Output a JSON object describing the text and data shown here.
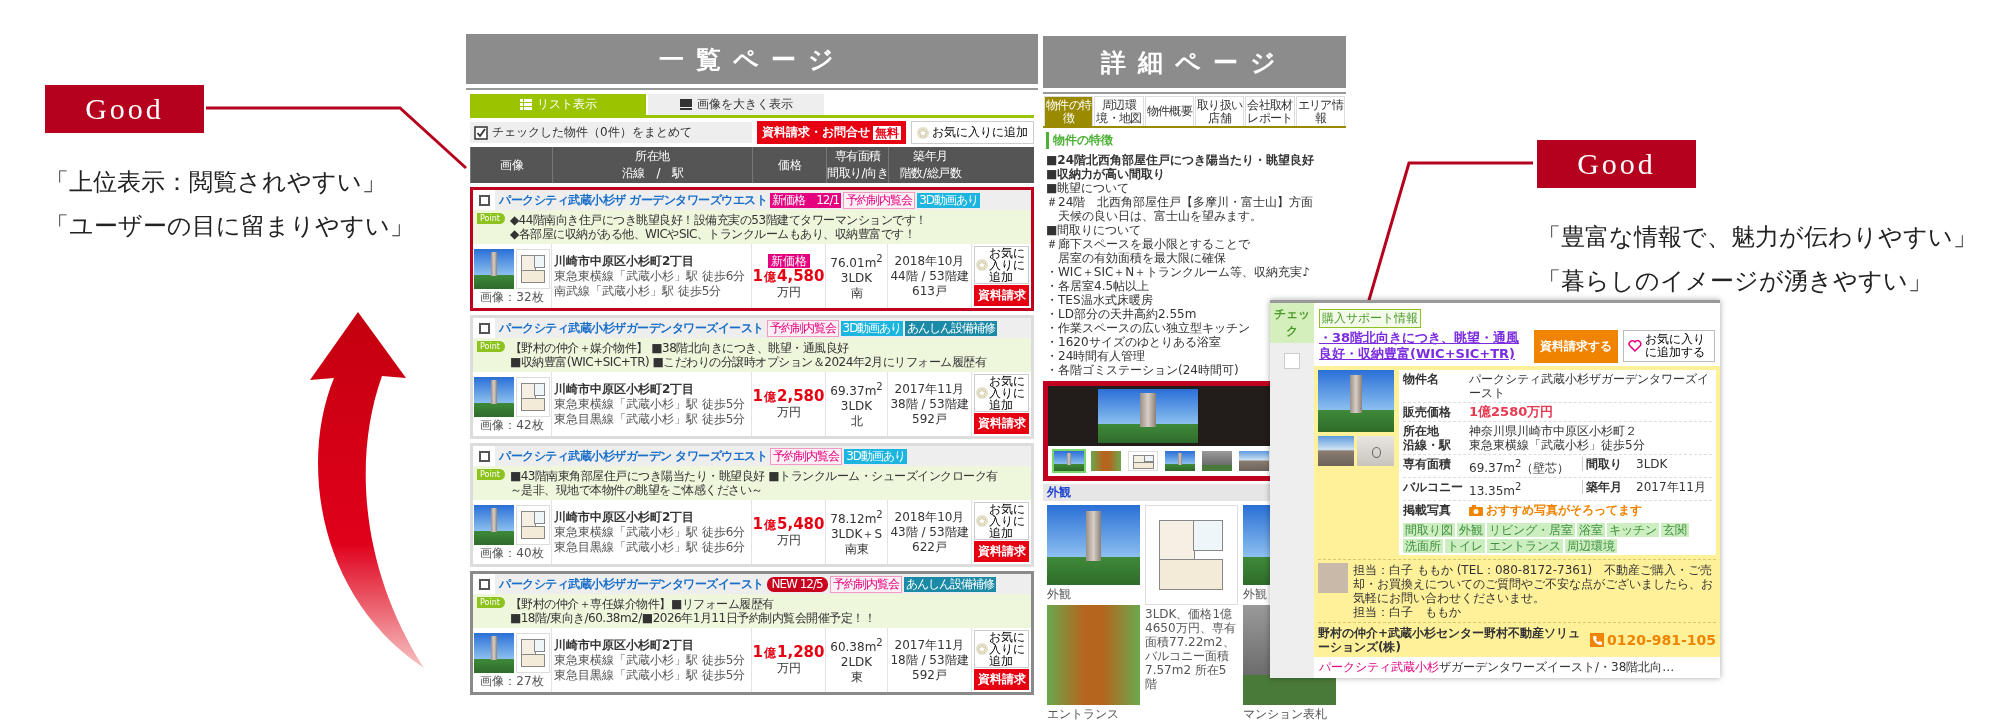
{
  "callouts": [
    {
      "label": "Good",
      "lines": [
        "「上位表示：閲覧されやすい」",
        "「ユーザーの目に留まりやすい」"
      ]
    },
    {
      "label": "Good",
      "lines": [
        "「豊富な情報で、魅力が伝わりやすい」",
        "「暮らしのイメージが湧きやすい」"
      ]
    }
  ],
  "list_page": {
    "heading": "一覧ページ",
    "tabs": [
      {
        "label": "リスト表示",
        "selected": true
      },
      {
        "label": "画像を大きく表示",
        "selected": false
      }
    ],
    "toolbar": {
      "check_label": "チェックした物件（0件）をまとめて",
      "request_button": "資料請求・お問合せ",
      "request_badge": "無料",
      "favorite_button": "お気に入りに追加"
    },
    "columns": [
      [
        "画像"
      ],
      [
        "所在地",
        "沿線　/　駅"
      ],
      [
        "価格"
      ],
      [
        "専有面積",
        "間取り/向き"
      ],
      [
        "築年月",
        "階数/総戸数"
      ]
    ],
    "listings": [
      {
        "color": "#c0001f",
        "checked": false,
        "title": "パークシティ武蔵小杉ザ ガーデンタワーズウエスト",
        "tags": [
          {
            "kind": "price",
            "label": "新価格　12/1"
          },
          {
            "kind": "event",
            "label": "予約制内覧会"
          },
          {
            "kind": "video",
            "label": "3D動画あり"
          }
        ],
        "point_badge": "Point",
        "point_lines": [
          "◆44階南向き住戸につき眺望良好！設備充実の53階建てタワーマンションです！",
          "◆各部屋に収納がある他、WICやSIC、トランクルームもあり、収納豊富です！"
        ],
        "image_count": "画像：32枚",
        "address": "川崎市中原区小杉町2丁目",
        "access": [
          "東急東横線「武蔵小杉」駅 徒歩6分",
          "南武線「武蔵小杉」駅 徒歩5分"
        ],
        "price_badge": "新価格",
        "price_oku": "1",
        "price_oku_unit": "億",
        "price_man": "4,580",
        "price_unit": "万円",
        "area": "76.01m$^{2}$",
        "layout": "3LDK",
        "direction": "南",
        "built": "2018年10月",
        "floors": "44階 / 53階建",
        "units": "613戸",
        "favorite": "お気に入りに追加",
        "request": "資料請求"
      },
      {
        "color": "#dcdcdc",
        "checked": false,
        "title": "パークシティ武蔵小杉ザガーデンタワーズイースト",
        "tags": [
          {
            "kind": "event",
            "label": "予約制内覧会"
          },
          {
            "kind": "video",
            "label": "3D動画あり"
          },
          {
            "kind": "warranty",
            "label": "あんしん設備補修"
          }
        ],
        "point_badge": "Point",
        "point_lines": [
          "【野村の仲介＋媒介物件】 ■38階北向きにつき、眺望・通風良好",
          "■収納豊富(WIC+SIC+TR) ■こだわりの分譲時オプション＆2024年2月にリフォーム履歴有"
        ],
        "image_count": "画像：42枚",
        "address": "川崎市中原区小杉町2丁目",
        "access": [
          "東急東横線「武蔵小杉」駅 徒歩5分",
          "東急目黒線「武蔵小杉」駅 徒歩5分"
        ],
        "price_oku": "1",
        "price_oku_unit": "億",
        "price_man": "2,580",
        "price_unit": "万円",
        "area": "69.37m$^{2}$",
        "layout": "3LDK",
        "direction": "北",
        "built": "2017年11月",
        "floors": "38階 / 53階建",
        "units": "592戸",
        "favorite": "お気に入りに追加",
        "request": "資料請求"
      },
      {
        "color": "#dcdcdc",
        "checked": false,
        "title": "パークシティ武蔵小杉ザガーデン タワーズウエスト",
        "tags": [
          {
            "kind": "event",
            "label": "予約制内覧会"
          },
          {
            "kind": "video",
            "label": "3D動画あり"
          }
        ],
        "point_badge": "Point",
        "point_lines": [
          "■43階南東角部屋住戸につき陽当たり・眺望良好 ■トランクルーム・シューズインクローク有",
          "～是非、現地で本物件の眺望をご体感ください～"
        ],
        "image_count": "画像：40枚",
        "address": "川崎市中原区小杉町2丁目",
        "access": [
          "東急東横線「武蔵小杉」駅 徒歩6分",
          "東急目黒線「武蔵小杉」駅 徒歩6分"
        ],
        "price_oku": "1",
        "price_oku_unit": "億",
        "price_man": "5,480",
        "price_unit": "万円",
        "area": "78.12m$^{2}$",
        "layout": "3LDK＋S",
        "direction": "南東",
        "built": "2018年10月",
        "floors": "43階 / 53階建",
        "units": "622戸",
        "favorite": "お気に入りに追加",
        "request": "資料請求"
      },
      {
        "color": "#8a8a8a",
        "checked": false,
        "title": "パークシティ武蔵小杉ザガーデンタワーズイースト",
        "tags": [
          {
            "kind": "new",
            "label": "NEW 12/5"
          },
          {
            "kind": "event",
            "label": "予約制内覧会"
          },
          {
            "kind": "warranty",
            "label": "あんしん設備補修"
          }
        ],
        "point_badge": "Point",
        "point_lines": [
          "【野村の仲介＋専任媒介物件】■リフォーム履歴有",
          "■18階/東向き/60.38m2/■2026年1月11日予約制内覧会開催予定！！"
        ],
        "image_count": "画像：27枚",
        "address": "川崎市中原区小杉町2丁目",
        "access": [
          "東急東横線「武蔵小杉」駅 徒歩5分",
          "東急目黒線「武蔵小杉」駅 徒歩5分"
        ],
        "price_oku": "1",
        "price_oku_unit": "億",
        "price_man": "1,280",
        "price_unit": "万円",
        "area": "60.38m$^{2}$",
        "layout": "2LDK",
        "direction": "東",
        "built": "2017年11月",
        "floors": "18階 / 53階建",
        "units": "592戸",
        "favorite": "お気に入りに追加",
        "request": "資料請求"
      }
    ]
  },
  "detail_page": {
    "heading": "詳細ページ",
    "tabs": [
      {
        "label": "物件の特徴",
        "selected": true
      },
      {
        "label": "周辺環境・地図",
        "selected": false
      },
      {
        "label": "物件概要",
        "selected": false
      },
      {
        "label": "取り扱い店舗",
        "selected": false
      },
      {
        "label": "会社取材レポート",
        "selected": false
      },
      {
        "label": "エリア情報",
        "selected": false
      }
    ],
    "section_title": "物件の特徴",
    "features": [
      {
        "kind": "bold",
        "text": "■24階北西角部屋住戸につき陽当たり・眺望良好"
      },
      {
        "kind": "bold",
        "text": "■収納力が高い間取り"
      },
      {
        "kind": "plain",
        "text": "■眺望について"
      },
      {
        "kind": "plain",
        "text": "＃24階　北西角部屋住戸【多摩川・富士山】方面"
      },
      {
        "kind": "plain",
        "text": "　天候の良い日は、富士山を望みます。"
      },
      {
        "kind": "plain",
        "text": "■間取りについて"
      },
      {
        "kind": "plain",
        "text": "＃廊下スペースを最小限とすることで"
      },
      {
        "kind": "plain",
        "text": "　居室の有効面積を最大限に確保"
      },
      {
        "kind": "plain",
        "text": "・WIC＋SIC＋N＋トランクルーム等、収納充実♪"
      },
      {
        "kind": "plain",
        "text": "・各居室4.5帖以上"
      },
      {
        "kind": "plain",
        "text": "・TES温水式床暖房"
      },
      {
        "kind": "plain",
        "text": "・LD部分の天井高約2.55m"
      },
      {
        "kind": "plain",
        "text": "・作業スペースの広い独立型キッチン"
      },
      {
        "kind": "plain",
        "text": "・1620サイズのゆとりある浴室"
      },
      {
        "kind": "plain",
        "text": "・24時間有人管理"
      },
      {
        "kind": "plain",
        "text": "・各階ゴミステーション(24時間可)"
      }
    ],
    "thumbnails": [
      {
        "kind": "tower",
        "selected": true
      },
      {
        "kind": "entrance",
        "selected": false
      },
      {
        "kind": "plan",
        "selected": false
      },
      {
        "kind": "tower",
        "selected": false
      },
      {
        "kind": "sign",
        "selected": false
      },
      {
        "kind": "view",
        "selected": false
      }
    ],
    "photo_category": "外観",
    "gallery": [
      {
        "items": [
          {
            "kind": "tower",
            "caption": "外観"
          },
          {
            "kind": "entrance",
            "caption": "エントランス"
          }
        ]
      },
      {
        "items": [
          {
            "kind": "plan",
            "caption": "3LDK、価格1億4650万円、専有面積77.22m2、バルコニー面積7.57m2 所在5階"
          }
        ]
      },
      {
        "items": [
          {
            "kind": "tower",
            "caption": "外観"
          },
          {
            "kind": "sign",
            "caption": "マンション表札"
          }
        ]
      }
    ]
  },
  "detail_popup": {
    "check_label": "チェック",
    "checked": false,
    "tag": "購入サポート情報",
    "title": "・38階北向きにつき、眺望・通風良好・収納豊富(WIC+SIC+TR)",
    "request_button": "資料請求する",
    "favorite_button": "お気に入りに追加する",
    "facts": [
      {
        "kind": "text",
        "label": "物件名",
        "value": "パークシティ武蔵小杉ザガーデンタワーズイースト"
      },
      {
        "kind": "price",
        "label": "販売価格",
        "value": "1億2580万円"
      },
      {
        "kind": "stack",
        "labels": [
          "所在地",
          "沿線・駅"
        ],
        "values": [
          "神奈川県川崎市中原区小杉町２",
          "東急東横線「武蔵小杉」徒歩5分"
        ]
      },
      {
        "kind": "pair",
        "label": "専有面積",
        "value": "69.37m$^{2}$（壁芯）",
        "label2": "間取り",
        "value2": "3LDK"
      },
      {
        "kind": "pair",
        "label": "バルコニー",
        "value": "13.35m$^{2}$",
        "label2": "築年月",
        "value2": "2017年11月"
      },
      {
        "kind": "photos",
        "label": "掲載写真",
        "value": "おすすめ写真がそろってます",
        "tags": [
          "間取り図",
          "外観",
          "リビング・居室",
          "浴室",
          "キッチン",
          "玄関",
          "洗面所",
          "トイレ",
          "エントランス",
          "周辺環境"
        ]
      }
    ],
    "contact": {
      "text": "担当：白子 ももか (TEL：080-8172-7361)　不動産ご購入・ご売却・お買換えについてのご質問やご不安な点がございましたら、お気軽にお問い合わせくださいませ。",
      "name": "担当：白子　ももか"
    },
    "agency": "野村の仲介+武蔵小杉センター野村不動産ソリューションズ(株)",
    "phone": "0120-981-105",
    "breadcrumb_link": "パークシティ武蔵小杉",
    "breadcrumb_rest": "ザガーデンタワーズイースト/・38階北向…"
  }
}
